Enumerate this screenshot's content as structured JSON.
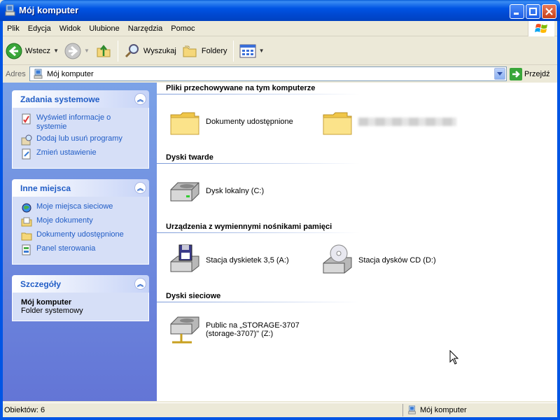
{
  "window": {
    "title": "Mój komputer",
    "icon": "my-computer-icon",
    "buttons": [
      "minimize",
      "maximize",
      "close"
    ]
  },
  "menu": {
    "items": [
      "Plik",
      "Edycja",
      "Widok",
      "Ulubione",
      "Narzędzia",
      "Pomoc"
    ]
  },
  "toolbar": {
    "back_label": "Wstecz",
    "search_label": "Wyszukaj",
    "folders_label": "Foldery"
  },
  "address": {
    "label": "Adres",
    "value": "Mój komputer",
    "go_label": "Przejdź"
  },
  "sidebar": {
    "system_tasks": {
      "title": "Zadania systemowe",
      "items": [
        {
          "label": "Wyświetl informacje o systemie",
          "icon": "system-info-icon"
        },
        {
          "label": "Dodaj lub usuń programy",
          "icon": "add-remove-programs-icon"
        },
        {
          "label": "Zmień ustawienie",
          "icon": "change-setting-icon"
        }
      ]
    },
    "other_places": {
      "title": "Inne miejsca",
      "items": [
        {
          "label": "Moje miejsca sieciowe",
          "icon": "network-places-icon"
        },
        {
          "label": "Moje dokumenty",
          "icon": "my-documents-icon"
        },
        {
          "label": "Dokumenty udostępnione",
          "icon": "shared-folder-icon"
        },
        {
          "label": "Panel sterowania",
          "icon": "control-panel-icon"
        }
      ]
    },
    "details": {
      "title": "Szczegóły",
      "name": "Mój komputer",
      "type": "Folder systemowy"
    }
  },
  "main": {
    "groups": [
      {
        "title": "Pliki przechowywane na tym komputerze",
        "items": [
          {
            "label": "Dokumenty udostępnione",
            "icon": "folder-icon"
          },
          {
            "label": "",
            "icon": "folder-icon",
            "blurred": true
          }
        ]
      },
      {
        "title": "Dyski twarde",
        "items": [
          {
            "label": "Dysk lokalny (C:)",
            "icon": "hard-drive-icon"
          }
        ]
      },
      {
        "title": "Urządzenia z wymiennymi nośnikami pamięci",
        "items": [
          {
            "label": "Stacja dyskietek 3,5 (A:)",
            "icon": "floppy-drive-icon"
          },
          {
            "label": "Stacja dysków CD (D:)",
            "icon": "cd-drive-icon"
          }
        ]
      },
      {
        "title": "Dyski sieciowe",
        "items": [
          {
            "label_line1": "Public na „STORAGE-3707",
            "label_line2": "(storage-3707)\" (Z:)",
            "icon": "network-drive-icon"
          }
        ]
      }
    ]
  },
  "status": {
    "objects": "Obiektów: 6",
    "location": "Mój komputer"
  },
  "colors": {
    "titlebar": "#0054e3",
    "sidebar_link": "#215dc6",
    "sidebar_bg": "#6f8ddf"
  }
}
